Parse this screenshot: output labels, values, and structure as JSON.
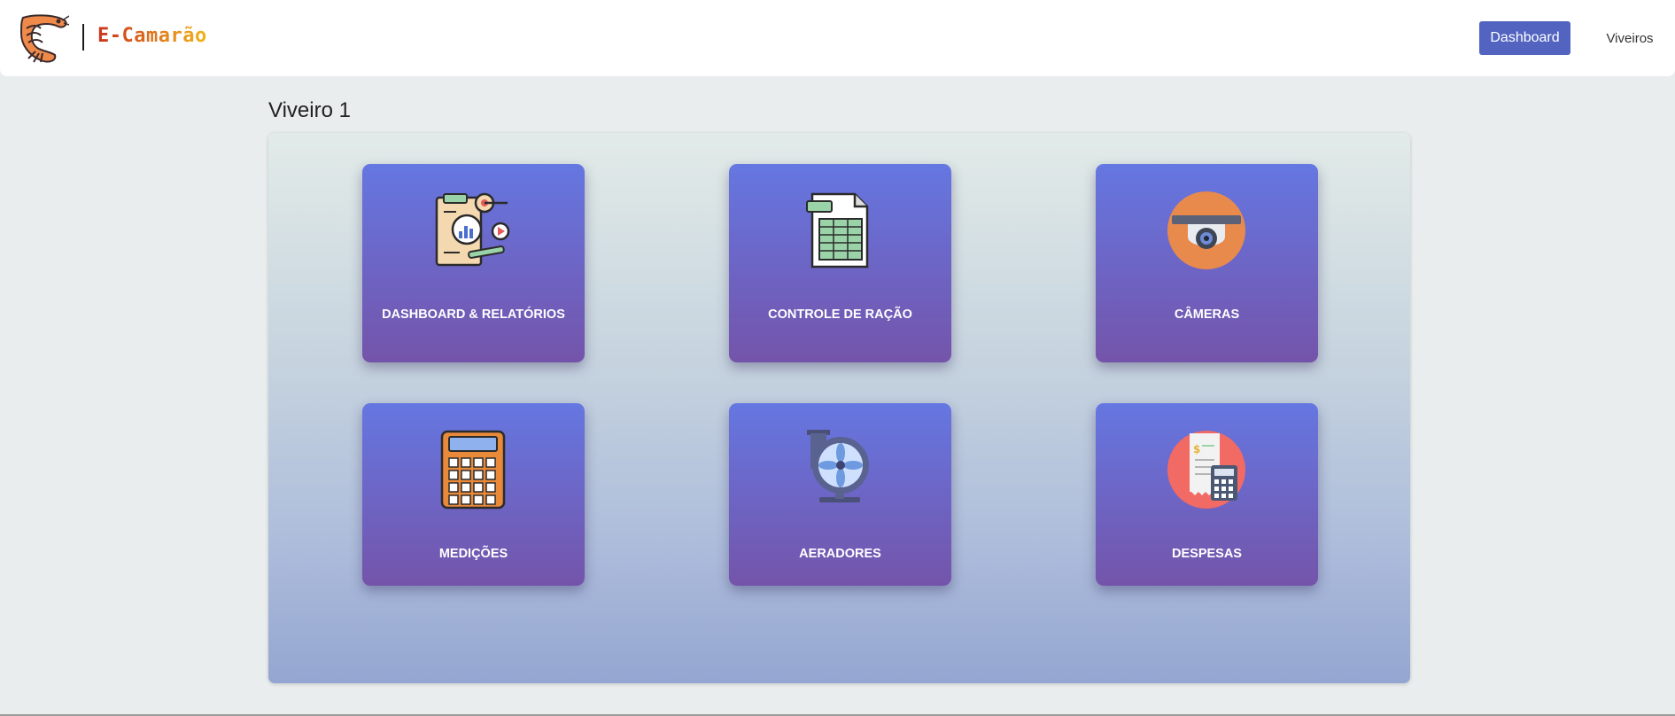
{
  "navbar": {
    "brand_name": "E-Camarão",
    "logo_icon": "shrimp-icon",
    "nav_dashboard": "Dashboard",
    "nav_viveiros": "Viveiros"
  },
  "page": {
    "title": "Viveiro 1"
  },
  "cards": [
    {
      "label": "DASHBOARD & RELATÓRIOS",
      "icon": "report-analytics-icon"
    },
    {
      "label": "CONTROLE DE RAÇÃO",
      "icon": "spreadsheet-icon"
    },
    {
      "label": "CÂMERAS",
      "icon": "security-camera-icon"
    },
    {
      "label": "MEDIÇÕES",
      "icon": "calculator-icon"
    },
    {
      "label": "AERADORES",
      "icon": "fan-aerator-icon"
    },
    {
      "label": "DESPESAS",
      "icon": "receipt-calculator-icon"
    }
  ],
  "colors": {
    "accent": "#5264c0",
    "card_top": "#6577e1",
    "card_bottom": "#7454aa"
  }
}
